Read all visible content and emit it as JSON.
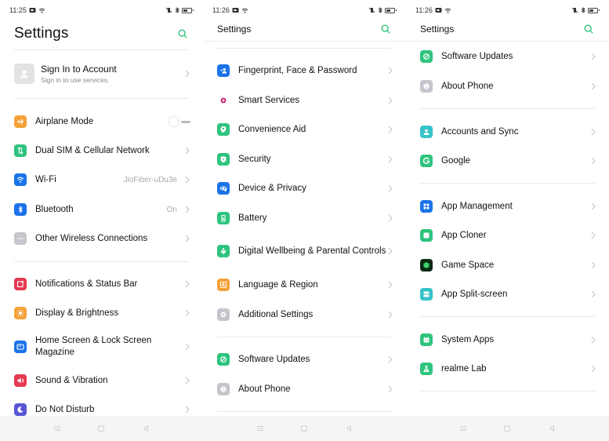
{
  "screens": [
    {
      "status": {
        "time": "11:25"
      },
      "header": {
        "title": "Settings"
      },
      "account": {
        "title": "Sign In to Account",
        "subtitle": "Sign in to use services."
      },
      "items": [
        {
          "label": "Airplane Mode",
          "icon": "airplane-icon",
          "color": "#f5a23a",
          "control": "toggle",
          "toggle_on": false
        },
        {
          "label": "Dual SIM & Cellular Network",
          "icon": "cellular-data-icon",
          "color": "#2fc47e"
        },
        {
          "label": "Wi-Fi",
          "icon": "wifi-icon",
          "color": "#1a73e8",
          "value": "JioFiber-uDu3e"
        },
        {
          "label": "Bluetooth",
          "icon": "bluetooth-icon",
          "color": "#1a73e8",
          "value": "On"
        },
        {
          "label": "Other Wireless Connections",
          "icon": "more-dots-icon",
          "color": "#c4c6cc"
        },
        {
          "label": "Notifications & Status Bar",
          "icon": "notification-icon",
          "color": "#e53950"
        },
        {
          "label": "Display & Brightness",
          "icon": "brightness-icon",
          "color": "#f5a23a"
        },
        {
          "label": "Home Screen & Lock Screen Magazine",
          "icon": "wallpaper-icon",
          "color": "#1a73e8"
        },
        {
          "label": "Sound & Vibration",
          "icon": "speaker-icon",
          "color": "#e53950"
        },
        {
          "label": "Do Not Disturb",
          "icon": "moon-icon",
          "color": "#5856d6"
        }
      ]
    },
    {
      "status": {
        "time": "11:26"
      },
      "header": {
        "title": "Settings"
      },
      "items": [
        {
          "label": "Fingerprint, Face & Password",
          "icon": "fingerprint-face-icon",
          "color": "#1a73e8"
        },
        {
          "label": "Smart Services",
          "icon": "smart-services-icon",
          "color": "#c2186b"
        },
        {
          "label": "Convenience Aid",
          "icon": "convenience-aid-icon",
          "color": "#2fc47e"
        },
        {
          "label": "Security",
          "icon": "shield-icon",
          "color": "#2fc47e"
        },
        {
          "label": "Device & Privacy",
          "icon": "privacy-eye-icon",
          "color": "#1a73e8"
        },
        {
          "label": "Battery",
          "icon": "battery-icon",
          "color": "#2fc47e"
        },
        {
          "label": "Digital Wellbeing & Parental Controls",
          "icon": "wellbeing-heart-icon",
          "color": "#2fc47e"
        },
        {
          "label": "Language & Region",
          "icon": "language-icon",
          "color": "#f5a23a"
        },
        {
          "label": "Additional Settings",
          "icon": "additional-settings-icon",
          "color": "#c4c6cc"
        },
        {
          "label": "Software Updates",
          "icon": "software-update-icon",
          "color": "#2fc47e"
        },
        {
          "label": "About Phone",
          "icon": "info-icon",
          "color": "#c4c6cc"
        }
      ]
    },
    {
      "status": {
        "time": "11:26"
      },
      "header": {
        "title": "Settings"
      },
      "items": [
        {
          "label": "Software Updates",
          "icon": "software-update-icon",
          "color": "#2fc47e"
        },
        {
          "label": "About Phone",
          "icon": "info-icon",
          "color": "#c4c6cc"
        },
        {
          "label": "Accounts and Sync",
          "icon": "account-sync-icon",
          "color": "#35c3c8"
        },
        {
          "label": "Google",
          "icon": "google-icon",
          "color": "#2fc47e"
        },
        {
          "label": "App Management",
          "icon": "app-grid-icon",
          "color": "#1a73e8"
        },
        {
          "label": "App Cloner",
          "icon": "app-cloner-icon",
          "color": "#2fc47e"
        },
        {
          "label": "Game Space",
          "icon": "game-space-icon",
          "color": "#0b2a12"
        },
        {
          "label": "App Split-screen",
          "icon": "split-screen-icon",
          "color": "#35c3c8"
        },
        {
          "label": "System Apps",
          "icon": "system-apps-icon",
          "color": "#2fc47e"
        },
        {
          "label": "realme Lab",
          "icon": "lab-flask-icon",
          "color": "#2fc47e"
        }
      ]
    }
  ],
  "colors": {
    "accent": "#2fc47e",
    "chevron": "#c8c8c8",
    "divider": "#e8e8e8"
  }
}
